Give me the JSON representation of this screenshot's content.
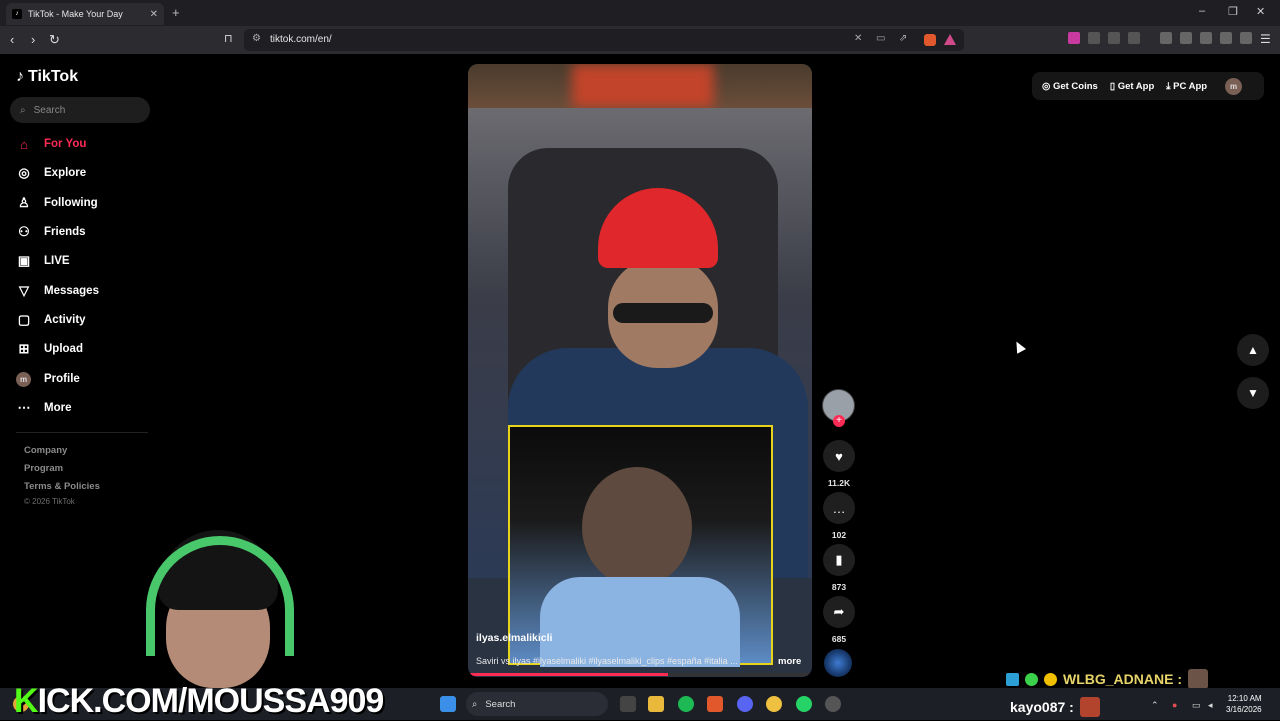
{
  "browser": {
    "tab_title": "TikTok - Make Your Day",
    "tab_close": "✕",
    "new_tab": "+",
    "url": "tiktok.com/en/",
    "window_controls": [
      "–",
      "❐",
      "✕"
    ]
  },
  "sidebar": {
    "logo_text": "TikTok",
    "search_placeholder": "Search",
    "items": [
      {
        "label": "For You",
        "icon": "home-icon",
        "active": true
      },
      {
        "label": "Explore",
        "icon": "compass-icon"
      },
      {
        "label": "Following",
        "icon": "person-icon"
      },
      {
        "label": "Friends",
        "icon": "friends-icon"
      },
      {
        "label": "LIVE",
        "icon": "live-icon"
      },
      {
        "label": "Messages",
        "icon": "send-icon"
      },
      {
        "label": "Activity",
        "icon": "activity-icon"
      },
      {
        "label": "Upload",
        "icon": "upload-icon"
      },
      {
        "label": "Profile",
        "icon": "avatar-icon"
      },
      {
        "label": "More",
        "icon": "more-icon"
      }
    ],
    "profile_initial": "m",
    "footer": [
      "Company",
      "Program",
      "Terms & Policies"
    ],
    "copyright": "© 2026 TikTok"
  },
  "topright": {
    "get_coins": "Get Coins",
    "get_app": "Get App",
    "pc_app": "PC App",
    "me_initial": "m"
  },
  "video": {
    "author": "ilyas.elmalikicli",
    "description": "Saviri vs ilyas #ilyaselmaliki #ilyaselmaliki_clips #españa #italia ...",
    "more": "more",
    "progress": 0.58
  },
  "actions": {
    "likes": "11.2K",
    "comments": "102",
    "saves": "873",
    "shares": "685",
    "follow_plus": "+"
  },
  "overlay": {
    "kick_prefix": "K",
    "kick_rest": "ICK.COM/MOUSSA909",
    "chat_user": "WLBG_ADNANE :",
    "taskbar_user": "kayo087 :"
  },
  "taskbar": {
    "search_label": "Search",
    "time": "12:10 AM",
    "date": "3/16/2026"
  },
  "colors": {
    "accent": "#fe2c55",
    "kick_green": "#53fc18"
  }
}
